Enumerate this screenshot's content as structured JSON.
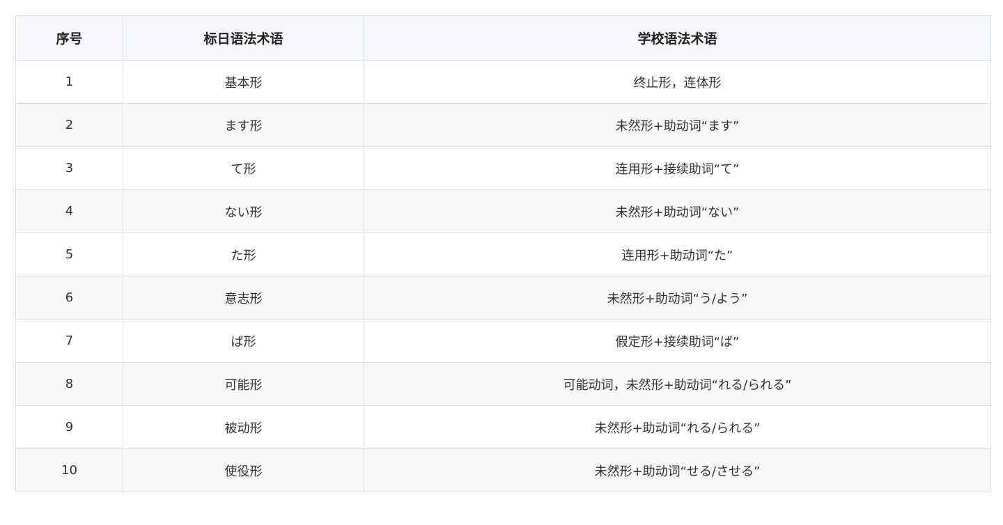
{
  "table": {
    "headers": [
      "序号",
      "标日语法术语",
      "学校语法术语"
    ],
    "rows": [
      {
        "index": "1",
        "standard_term": "基本形",
        "school_term": "终止形，连体形"
      },
      {
        "index": "2",
        "standard_term": "ます形",
        "school_term": "未然形+助动词“ます”"
      },
      {
        "index": "3",
        "standard_term": "て形",
        "school_term": "连用形+接续助词“て”"
      },
      {
        "index": "4",
        "standard_term": "ない形",
        "school_term": "未然形+助动词“ない”"
      },
      {
        "index": "5",
        "standard_term": "た形",
        "school_term": "连用形+助动词“た”"
      },
      {
        "index": "6",
        "standard_term": "意志形",
        "school_term": "未然形+助动词“う/よう”"
      },
      {
        "index": "7",
        "standard_term": "ば形",
        "school_term": "假定形+接续助词“ば”"
      },
      {
        "index": "8",
        "standard_term": "可能形",
        "school_term": "可能动词，未然形+助动词“れる/られる”"
      },
      {
        "index": "9",
        "standard_term": "被动形",
        "school_term": "未然形+助动词“れる/られる”"
      },
      {
        "index": "10",
        "standard_term": "使役形",
        "school_term": "未然形+助动词“せる/させる”"
      }
    ]
  }
}
